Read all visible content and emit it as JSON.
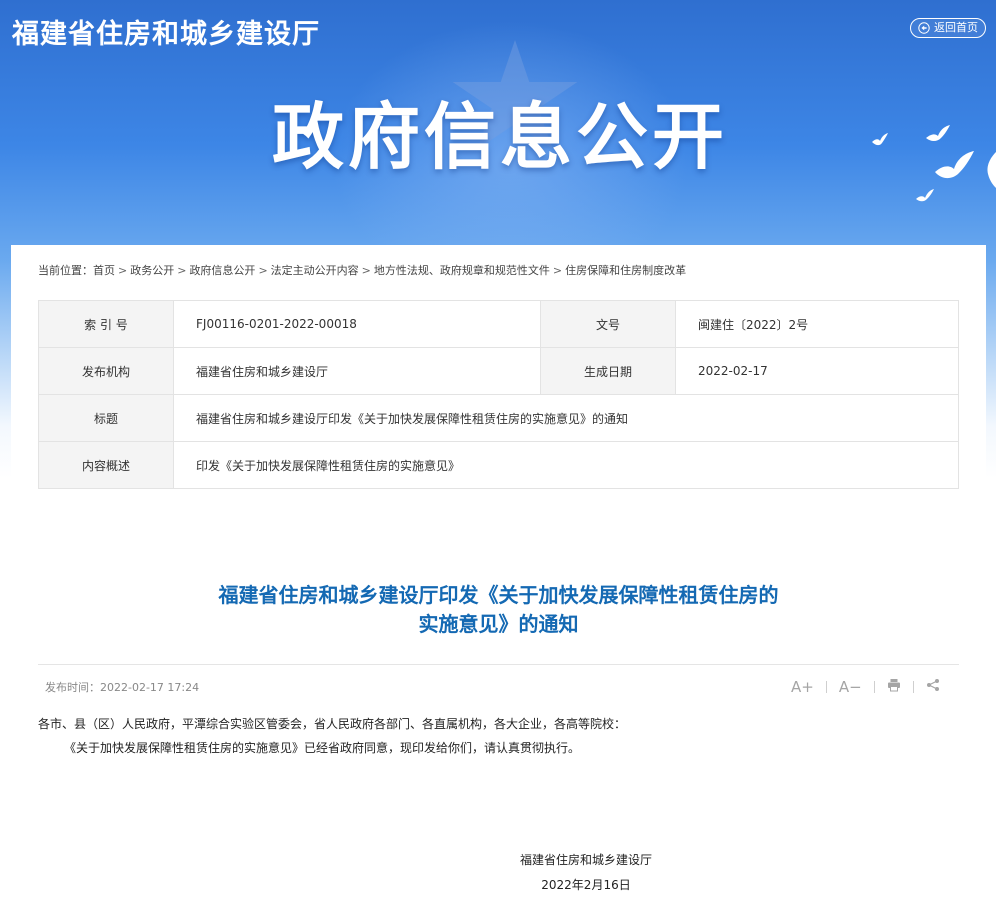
{
  "header": {
    "site_title": "福建省住房和城乡建设厅",
    "return_home": "返回首页",
    "banner_title": "政府信息公开"
  },
  "breadcrumb": {
    "prefix": "当前位置：",
    "items": [
      "首页",
      "政务公开",
      "政府信息公开",
      "法定主动公开内容",
      "地方性法规、政府规章和规范性文件",
      "住房保障和住房制度改革"
    ]
  },
  "meta": {
    "index_label": "索 引 号",
    "index_value": "FJ00116-0201-2022-00018",
    "docno_label": "文号",
    "docno_value": "闽建住〔2022〕2号",
    "issuer_label": "发布机构",
    "issuer_value": "福建省住房和城乡建设厅",
    "date_label": "生成日期",
    "date_value": "2022-02-17",
    "title_label": "标题",
    "title_value": "福建省住房和城乡建设厅印发《关于加快发展保障性租赁住房的实施意见》的通知",
    "summary_label": "内容概述",
    "summary_value": "印发《关于加快发展保障性租赁住房的实施意见》"
  },
  "article": {
    "title_line1": "福建省住房和城乡建设厅印发《关于加快发展保障性租赁住房的",
    "title_line2": "实施意见》的通知",
    "publish_time": "发布时间：2022-02-17 17:24",
    "tools": {
      "font_increase": "A+",
      "font_decrease": "A−"
    },
    "salutation": "各市、县（区）人民政府，平潭综合实验区管委会，省人民政府各部门、各直属机构，各大企业，各高等院校：",
    "paragraph": "《关于加快发展保障性租赁住房的实施意见》已经省政府同意，现印发给你们，请认真贯彻执行。",
    "signature": "福建省住房和城乡建设厅",
    "date": "2022年2月16日"
  },
  "colors": {
    "banner_blue": "#3d86e6",
    "title_blue": "#1469b3",
    "label_bg": "#f4f4f4"
  }
}
